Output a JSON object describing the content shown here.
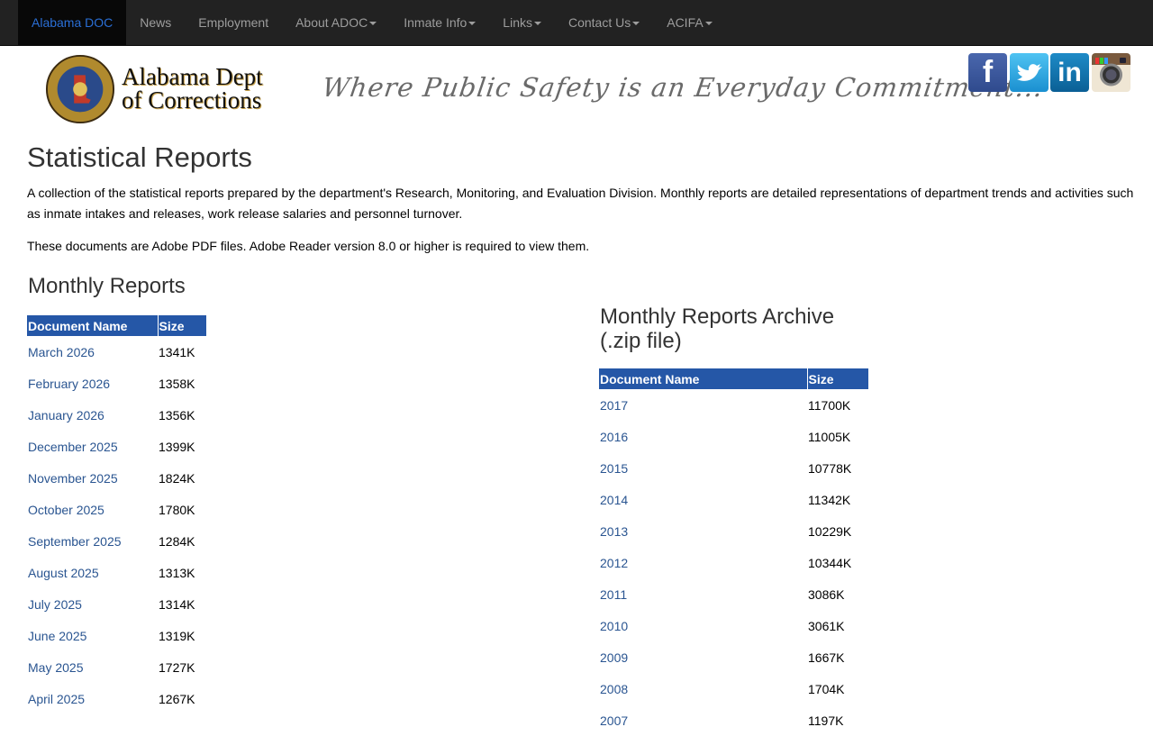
{
  "nav": {
    "brand": "Alabama DOC",
    "items": [
      {
        "label": "News",
        "dropdown": false
      },
      {
        "label": "Employment",
        "dropdown": false
      },
      {
        "label": "About ADOC",
        "dropdown": true
      },
      {
        "label": "Inmate Info",
        "dropdown": true
      },
      {
        "label": "Links",
        "dropdown": true
      },
      {
        "label": "Contact Us",
        "dropdown": true
      },
      {
        "label": "ACIFA",
        "dropdown": true
      }
    ]
  },
  "header": {
    "logo_line1": "Alabama Dept",
    "logo_line2": "of Corrections",
    "seal_text": "DEPARTMENT OF CORRECTIONS",
    "tagline": "Where Public Safety is an Everyday Commitment...",
    "social": {
      "facebook": "f",
      "linkedin": "in"
    }
  },
  "colors": {
    "accent": "#2557a7",
    "link": "#2a5591",
    "nav_bg": "#222222",
    "brand": "#2a6fd6"
  },
  "page": {
    "title": "Statistical Reports",
    "intro": "A collection of the statistical reports prepared by the department's Research, Monitoring, and Evaluation Division. Monthly reports are detailed representations of department trends and activities such as inmate intakes and releases, work release salaries and personnel turnover.",
    "pdf_note": "These documents are Adobe PDF files. Adobe Reader version 8.0 or higher is required to view them."
  },
  "monthly": {
    "title": "Monthly Reports",
    "columns": [
      "Document Name",
      "Size"
    ],
    "rows": [
      {
        "name": "March 2026",
        "size": "1341K"
      },
      {
        "name": "February 2026",
        "size": "1358K"
      },
      {
        "name": "January 2026",
        "size": "1356K"
      },
      {
        "name": "December 2025",
        "size": "1399K"
      },
      {
        "name": "November 2025",
        "size": "1824K"
      },
      {
        "name": "October 2025",
        "size": "1780K"
      },
      {
        "name": "September 2025",
        "size": "1284K"
      },
      {
        "name": "August 2025",
        "size": "1313K"
      },
      {
        "name": "July 2025",
        "size": "1314K"
      },
      {
        "name": "June 2025",
        "size": "1319K"
      },
      {
        "name": "May 2025",
        "size": "1727K"
      },
      {
        "name": "April 2025",
        "size": "1267K"
      }
    ]
  },
  "archive": {
    "title": "Monthly Reports Archive (.zip file)",
    "columns": [
      "Document Name",
      "Size"
    ],
    "rows": [
      {
        "name": "2017",
        "size": "11700K"
      },
      {
        "name": "2016",
        "size": "11005K"
      },
      {
        "name": "2015",
        "size": "10778K"
      },
      {
        "name": "2014",
        "size": "11342K"
      },
      {
        "name": "2013",
        "size": "10229K"
      },
      {
        "name": "2012",
        "size": "10344K"
      },
      {
        "name": "2011",
        "size": "3086K"
      },
      {
        "name": "2010",
        "size": "3061K"
      },
      {
        "name": "2009",
        "size": "1667K"
      },
      {
        "name": "2008",
        "size": "1704K"
      },
      {
        "name": "2007",
        "size": "1197K"
      }
    ]
  }
}
